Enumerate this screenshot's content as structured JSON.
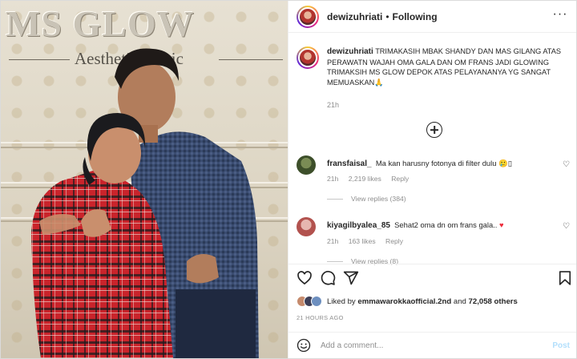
{
  "photo": {
    "sign_main": "MS GLOW",
    "sign_sub": "Aesthetic Clinic"
  },
  "header": {
    "username": "dewizuhriati",
    "separator": "•",
    "follow_state": "Following",
    "more": "···"
  },
  "caption": {
    "username": "dewizuhriati",
    "text": "TRIMAKASIH MBAK SHANDY DAN MAS GILANG ATAS PERAWATN WAJAH OMA GALA DAN OM FRANS JADI GLOWING TRIMAKSIH MS GLOW DEPOK ATAS PELAYANANYA YG SANGAT MEMUASKAN",
    "emoji": "🙏",
    "time": "21h"
  },
  "comments": [
    {
      "username": "fransfaisal_",
      "text": "Ma kan harusny fotonya di filter dulu",
      "emoji": "🥲",
      "trail": "▯",
      "time": "21h",
      "likes": "2,219 likes",
      "reply": "Reply",
      "view_replies": "View replies (384)"
    },
    {
      "username": "kiyagilbyalea_85",
      "text": "Sehat2 oma dn om frans gala..",
      "emoji": "♥",
      "time": "21h",
      "likes": "163 likes",
      "reply": "Reply",
      "view_replies": "View replies (8)"
    }
  ],
  "likes": {
    "prefix": "Liked by ",
    "user": "emmawarokkaofficial.2nd",
    "middle": " and ",
    "others": "72,058 others"
  },
  "timestamp": "21 HOURS AGO",
  "add_comment": {
    "placeholder": "Add a comment...",
    "post": "Post"
  },
  "colors": {
    "border": "#dbdbdb",
    "muted": "#8e8e8e",
    "heart": "#ed2b3a",
    "post_button": "#b2dffc"
  },
  "icons": {
    "like": "heart-outline-icon",
    "comment": "speech-bubble-icon",
    "share": "paper-plane-icon",
    "save": "bookmark-icon",
    "emoji": "smiley-icon",
    "more": "more-options-icon",
    "load_more": "plus-circle-icon"
  }
}
